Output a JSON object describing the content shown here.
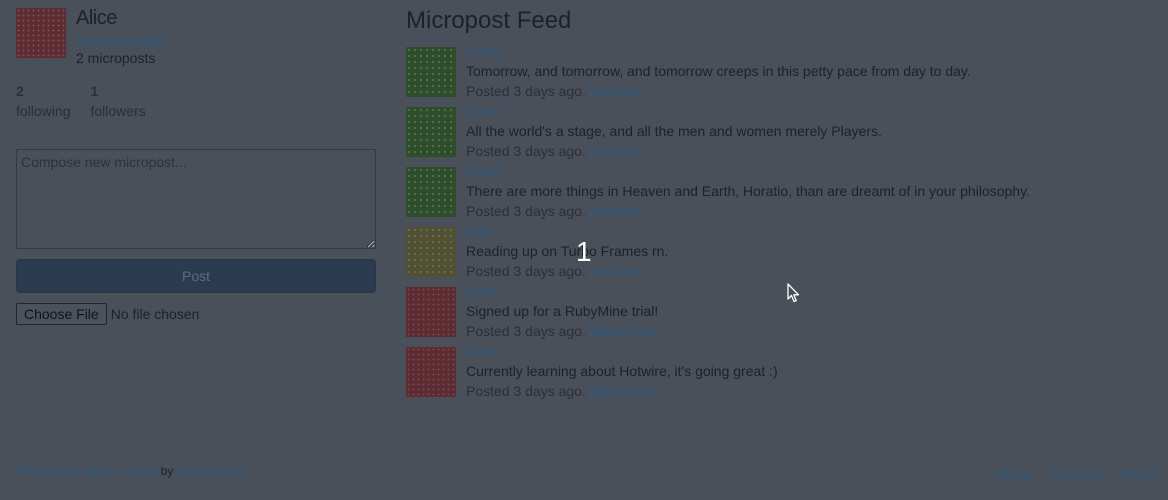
{
  "sidebar": {
    "user_name": "Alice",
    "profile_link": "view my profile",
    "microposts_count": "2 microposts",
    "stats": {
      "following_count": "2",
      "following_label": "following",
      "followers_count": "1",
      "followers_label": "followers"
    },
    "compose_placeholder": "Compose new micropost...",
    "post_button": "Post",
    "choose_file_button": "Choose File",
    "file_status": "No file chosen"
  },
  "feed": {
    "title": "Micropost Feed",
    "items": [
      {
        "user": "Carol",
        "content": "Tomorrow, and tomorrow, and tomorrow creeps in this petty pace from day to day.",
        "timestamp": "Posted 3 days ago.",
        "action1": "unfollow",
        "action2": ""
      },
      {
        "user": "Carol",
        "content": "All the world's a stage, and all the men and women merely Players.",
        "timestamp": "Posted 3 days ago.",
        "action1": "unfollow",
        "action2": ""
      },
      {
        "user": "Carol",
        "content": "There are more things in Heaven and Earth, Horatio, than are dreamt of in your philosophy.",
        "timestamp": "Posted 3 days ago.",
        "action1": "unfollow",
        "action2": ""
      },
      {
        "user": "Bob",
        "content": "Reading up on Turbo Frames rn.",
        "timestamp": "Posted 3 days ago.",
        "action1": "unfollow",
        "action2": ""
      },
      {
        "user": "Alice",
        "content": "Signed up for a RubyMine trial!",
        "timestamp": "Posted 3 days ago.",
        "action1": "delete",
        "action2": "edit"
      },
      {
        "user": "Alice",
        "content": "Currently learning about Hotwire, it's going great :)",
        "timestamp": "Posted 3 days ago.",
        "action1": "delete",
        "action2": "edit"
      }
    ]
  },
  "overlay": {
    "page_number": "1"
  },
  "footer": {
    "tutorial_link": "The Ruby on Rails Tutorial",
    "by_text": "by",
    "author_link": "Michael Hartl",
    "links": [
      "About",
      "Contact",
      "News"
    ]
  },
  "colors": {
    "background": "#4a505a",
    "link": "#2e5a80",
    "post_button": "#2c3c50"
  }
}
